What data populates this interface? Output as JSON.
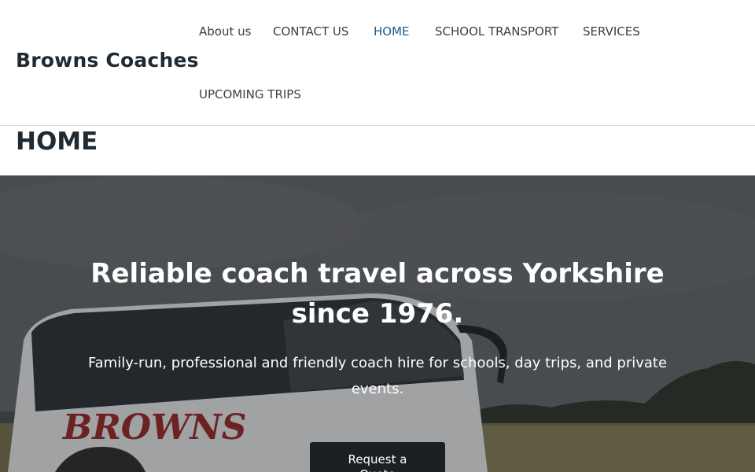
{
  "site": {
    "name": "Browns Coaches"
  },
  "nav": {
    "items": [
      {
        "label": "About us",
        "active": false
      },
      {
        "label": "CONTACT US",
        "active": false
      },
      {
        "label": "HOME",
        "active": true
      },
      {
        "label": "SCHOOL TRANSPORT",
        "active": false
      },
      {
        "label": "SERVICES",
        "active": false
      },
      {
        "label": "UPCOMING TRIPS",
        "active": false
      }
    ]
  },
  "page": {
    "title": "HOME"
  },
  "hero": {
    "heading": "Reliable coach travel across Yorkshire since 1976.",
    "subheading": "Family-run, professional and friendly coach hire for schools, day trips, and private events.",
    "cta_label": "Request a Quote",
    "coach_livery": "BROWNS"
  },
  "colors": {
    "accent": "#1c5d8c",
    "text": "#1f2a33",
    "cta_bg": "#1d2023"
  }
}
